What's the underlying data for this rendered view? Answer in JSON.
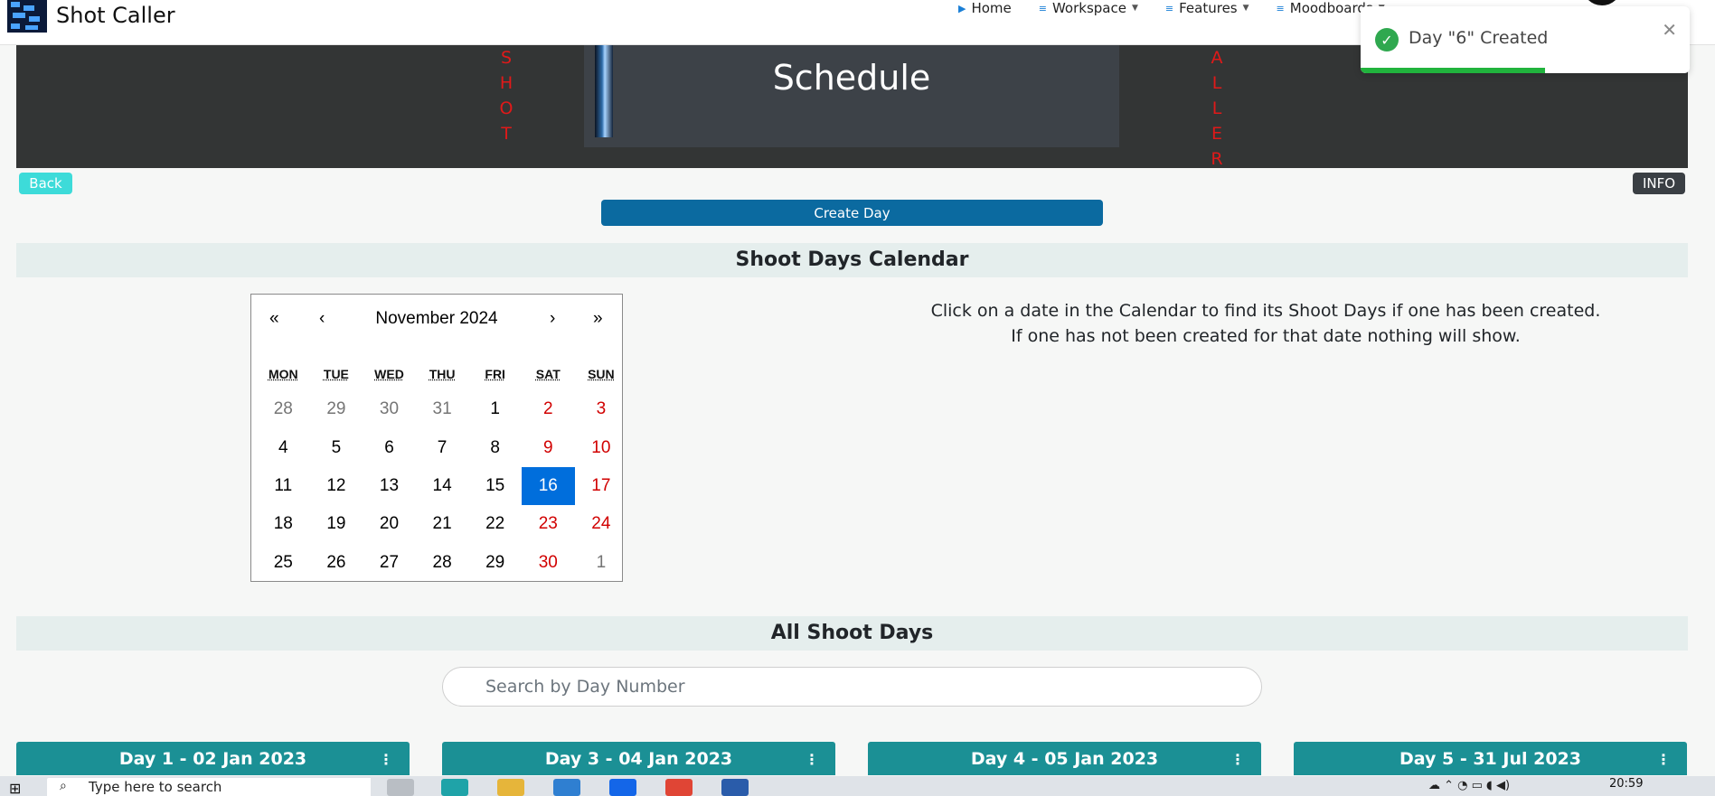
{
  "app": {
    "name": "Shot Caller"
  },
  "nav": {
    "items": [
      {
        "label": "Home",
        "icon": "play-icon"
      },
      {
        "label": "Workspace",
        "icon": "menu-icon"
      },
      {
        "label": "Features",
        "icon": "menu-icon"
      },
      {
        "label": "Moodboards",
        "icon": "menu-icon"
      }
    ]
  },
  "header": {
    "title": "Schedule",
    "left_vertical": [
      "S",
      "H",
      "O",
      "T"
    ],
    "right_vertical": [
      "A",
      "L",
      "L",
      "E",
      "R"
    ],
    "band_color": "#333535",
    "accent_red": "#e01919"
  },
  "buttons": {
    "back": "Back",
    "info": "INFO",
    "create_day": "Create Day"
  },
  "sections": {
    "calendar_title": "Shoot Days Calendar",
    "all_days_title": "All Shoot Days"
  },
  "calendar": {
    "month_label": "November 2024",
    "nav": {
      "prev_year": "«",
      "prev_month": "‹",
      "next_month": "›",
      "next_year": "»"
    },
    "weekdays": [
      "MON",
      "TUE",
      "WED",
      "THU",
      "FRI",
      "SAT",
      "SUN"
    ],
    "days": [
      {
        "n": "28",
        "neighbor": true
      },
      {
        "n": "29",
        "neighbor": true
      },
      {
        "n": "30",
        "neighbor": true
      },
      {
        "n": "31",
        "neighbor": true
      },
      {
        "n": "1"
      },
      {
        "n": "2"
      },
      {
        "n": "3"
      },
      {
        "n": "4"
      },
      {
        "n": "5"
      },
      {
        "n": "6"
      },
      {
        "n": "7"
      },
      {
        "n": "8"
      },
      {
        "n": "9"
      },
      {
        "n": "10"
      },
      {
        "n": "11"
      },
      {
        "n": "12"
      },
      {
        "n": "13"
      },
      {
        "n": "14"
      },
      {
        "n": "15"
      },
      {
        "n": "16",
        "active": true
      },
      {
        "n": "17"
      },
      {
        "n": "18"
      },
      {
        "n": "19"
      },
      {
        "n": "20"
      },
      {
        "n": "21"
      },
      {
        "n": "22"
      },
      {
        "n": "23"
      },
      {
        "n": "24"
      },
      {
        "n": "25"
      },
      {
        "n": "26"
      },
      {
        "n": "27"
      },
      {
        "n": "28"
      },
      {
        "n": "29"
      },
      {
        "n": "30"
      },
      {
        "n": "1",
        "neighbor": true
      }
    ],
    "help_line1": "Click on a date in the Calendar to find its Shoot Days if one has been created.",
    "help_line2": "If one has not been created for that date nothing will show.",
    "active_color": "#006edc",
    "weekend_color": "#d10000"
  },
  "search": {
    "placeholder": "Search by Day Number"
  },
  "day_cards": [
    {
      "title": "Day 1 - 02 Jan 2023"
    },
    {
      "title": "Day 3 - 04 Jan 2023"
    },
    {
      "title": "Day 4 - 05 Jan 2023"
    },
    {
      "title": "Day 5 - 31 Jul 2023"
    }
  ],
  "toast": {
    "message": "Day \"6\" Created",
    "progress_fraction": 0.56,
    "color": "#21b33d"
  },
  "taskbar": {
    "search_text": "Type here to search",
    "clock": "20:59"
  }
}
